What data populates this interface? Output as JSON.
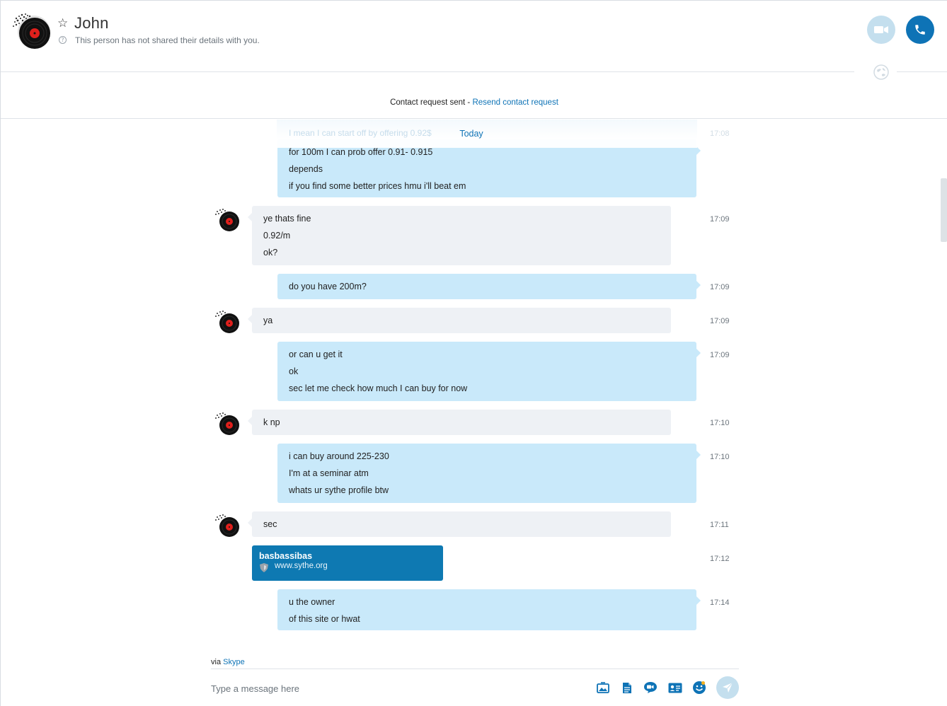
{
  "header": {
    "name": "John",
    "subtitle": "This person has not shared their details with you."
  },
  "banner": {
    "text": "Contact request sent - ",
    "link": "Resend contact request"
  },
  "chat": {
    "date_separator": "Today",
    "ghost_text": "I mean I can start off by offering 0.92$",
    "ghost_time": "17:08",
    "messages": [
      {
        "dir": "out",
        "lines": [
          "for 100m I can prob offer 0.91- 0.915",
          "depends",
          "if you find some better prices hmu i'll beat em"
        ],
        "time": ""
      },
      {
        "dir": "in",
        "lines": [
          "ye thats fine",
          "0.92/m",
          "ok?"
        ],
        "time": "17:09"
      },
      {
        "dir": "out",
        "lines": [
          "do you have 200m?"
        ],
        "time": "17:09"
      },
      {
        "dir": "in",
        "lines": [
          "ya"
        ],
        "time": "17:09"
      },
      {
        "dir": "out",
        "lines": [
          "or can u get it",
          "ok",
          "sec let me check how much I can buy for now"
        ],
        "time": "17:09"
      },
      {
        "dir": "in",
        "lines": [
          "k np"
        ],
        "time": "17:10"
      },
      {
        "dir": "out",
        "lines": [
          "i can buy around 225-230",
          "I'm at a seminar atm",
          "whats ur sythe profile btw"
        ],
        "time": "17:10"
      },
      {
        "dir": "in",
        "lines": [
          "sec"
        ],
        "time": "17:11"
      },
      {
        "dir": "link",
        "title": "basbassibas",
        "url": "www.sythe.org",
        "time": "17:12"
      },
      {
        "dir": "out",
        "lines": [
          "u the owner",
          "of this site or hwat"
        ],
        "time": "17:14"
      }
    ]
  },
  "composer": {
    "via_prefix": "via ",
    "via_link": "Skype",
    "placeholder": "Type a message here",
    "tools": [
      "media-icon",
      "file-icon",
      "video-message-icon",
      "contact-card-icon",
      "emoticon-icon"
    ]
  },
  "colors": {
    "accent": "#0e73b6",
    "outgoing_bubble": "#c9e9fa",
    "incoming_bubble": "#eef1f5",
    "link_card": "#0e79b2"
  }
}
